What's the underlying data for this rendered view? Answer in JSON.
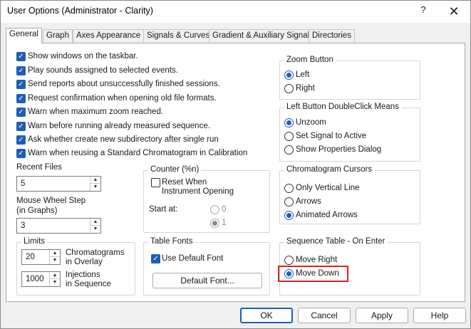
{
  "window": {
    "title": "User Options (Administrator - Clarity)",
    "help_glyph": "?",
    "close_glyph": "✕"
  },
  "tabs": [
    "General",
    "Graph",
    "Axes Appearance",
    "Signals & Curves",
    "Gradient & Auxiliary Signals",
    "Directories"
  ],
  "active_tab": "General",
  "options": [
    {
      "label": "Show windows on the taskbar.",
      "checked": true
    },
    {
      "label": "Play sounds assigned to selected events.",
      "checked": true
    },
    {
      "label": "Send reports about unsuccessfully finished sessions.",
      "checked": true
    },
    {
      "label": "Request confirmation when opening old file formats.",
      "checked": true
    },
    {
      "label": "Warn when maximum zoom reached.",
      "checked": true
    },
    {
      "label": "Warn before running already measured sequence.",
      "checked": true
    },
    {
      "label": "Ask whether create new subdirectory after single run",
      "checked": true
    },
    {
      "label": "Warn when reusing a Standard Chromatogram in Calibration",
      "checked": true
    }
  ],
  "recent_files": {
    "label": "Recent Files",
    "value": "5"
  },
  "mouse_wheel": {
    "label_line1": "Mouse Wheel Step",
    "label_line2": "(in Graphs)",
    "value": "3"
  },
  "limits": {
    "title": "Limits",
    "chromatograms": {
      "value": "20",
      "label_line1": "Chromatograms",
      "label_line2": "in Overlay"
    },
    "injections": {
      "value": "1000",
      "label_line1": "Injections",
      "label_line2": "in Sequence"
    }
  },
  "counter": {
    "title": "Counter (%n)",
    "reset_line1": "Reset When",
    "reset_line2": "Instrument Opening",
    "reset_checked": false,
    "start_at_label": "Start at:",
    "start_options": [
      "0",
      "1"
    ],
    "start_selected": "1"
  },
  "table_fonts": {
    "title": "Table Fonts",
    "use_default_label": "Use Default Font",
    "use_default_checked": true,
    "default_font_button": "Default Font..."
  },
  "zoom_button": {
    "title": "Zoom Button",
    "options": [
      "Left",
      "Right"
    ],
    "selected": "Left"
  },
  "left_dblclick": {
    "title": "Left Button DoubleClick Means",
    "options": [
      "Unzoom",
      "Set Signal to Active",
      "Show Properties Dialog"
    ],
    "selected": "Unzoom"
  },
  "cursors": {
    "title": "Chromatogram Cursors",
    "options": [
      "Only Vertical Line",
      "Arrows",
      "Animated Arrows"
    ],
    "selected": "Animated Arrows"
  },
  "seq_enter": {
    "title": "Sequence Table - On Enter",
    "options": [
      "Move Right",
      "Move Down"
    ],
    "selected": "Move Down"
  },
  "buttons": {
    "ok": "OK",
    "cancel": "Cancel",
    "apply": "Apply",
    "help": "Help"
  },
  "colors": {
    "accent": "#1e5fb4",
    "highlight": "#e02020"
  }
}
